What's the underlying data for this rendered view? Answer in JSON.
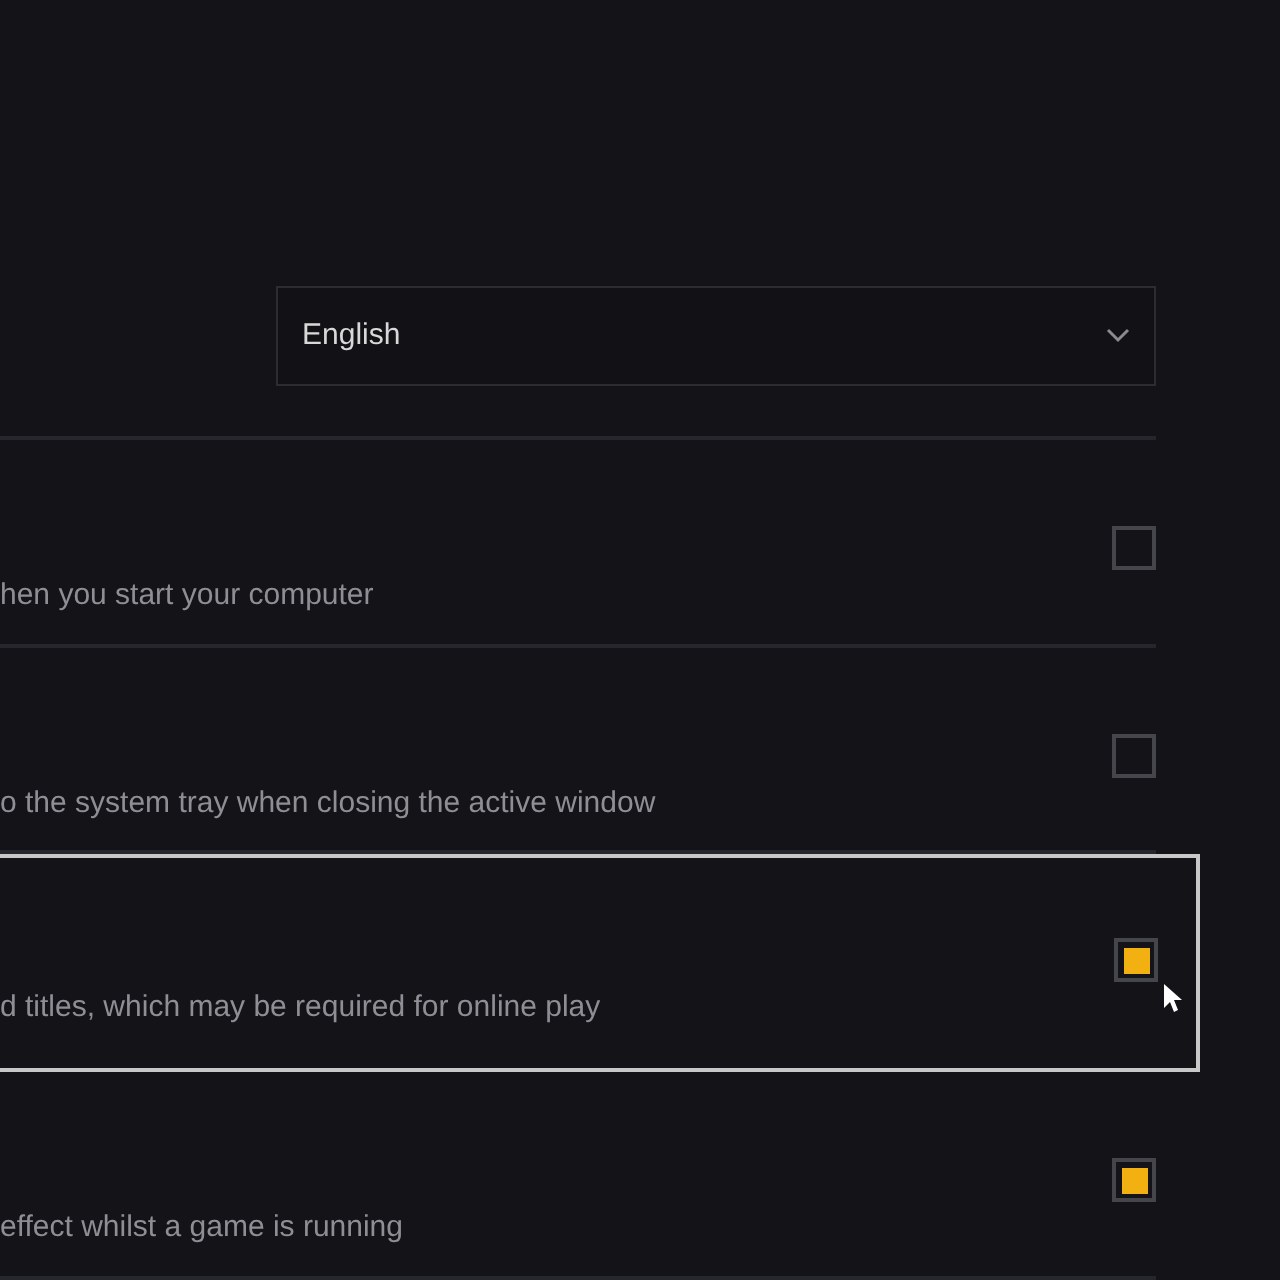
{
  "language_select": {
    "value": "English"
  },
  "options": [
    {
      "description": "hen you start your computer",
      "checked": false,
      "focused": false
    },
    {
      "description": "o the system tray when closing the active window",
      "checked": false,
      "focused": false
    },
    {
      "description": "d titles, which may be required for online play",
      "checked": true,
      "focused": true
    },
    {
      "description": "effect whilst a game is running",
      "checked": true,
      "focused": false
    }
  ]
}
